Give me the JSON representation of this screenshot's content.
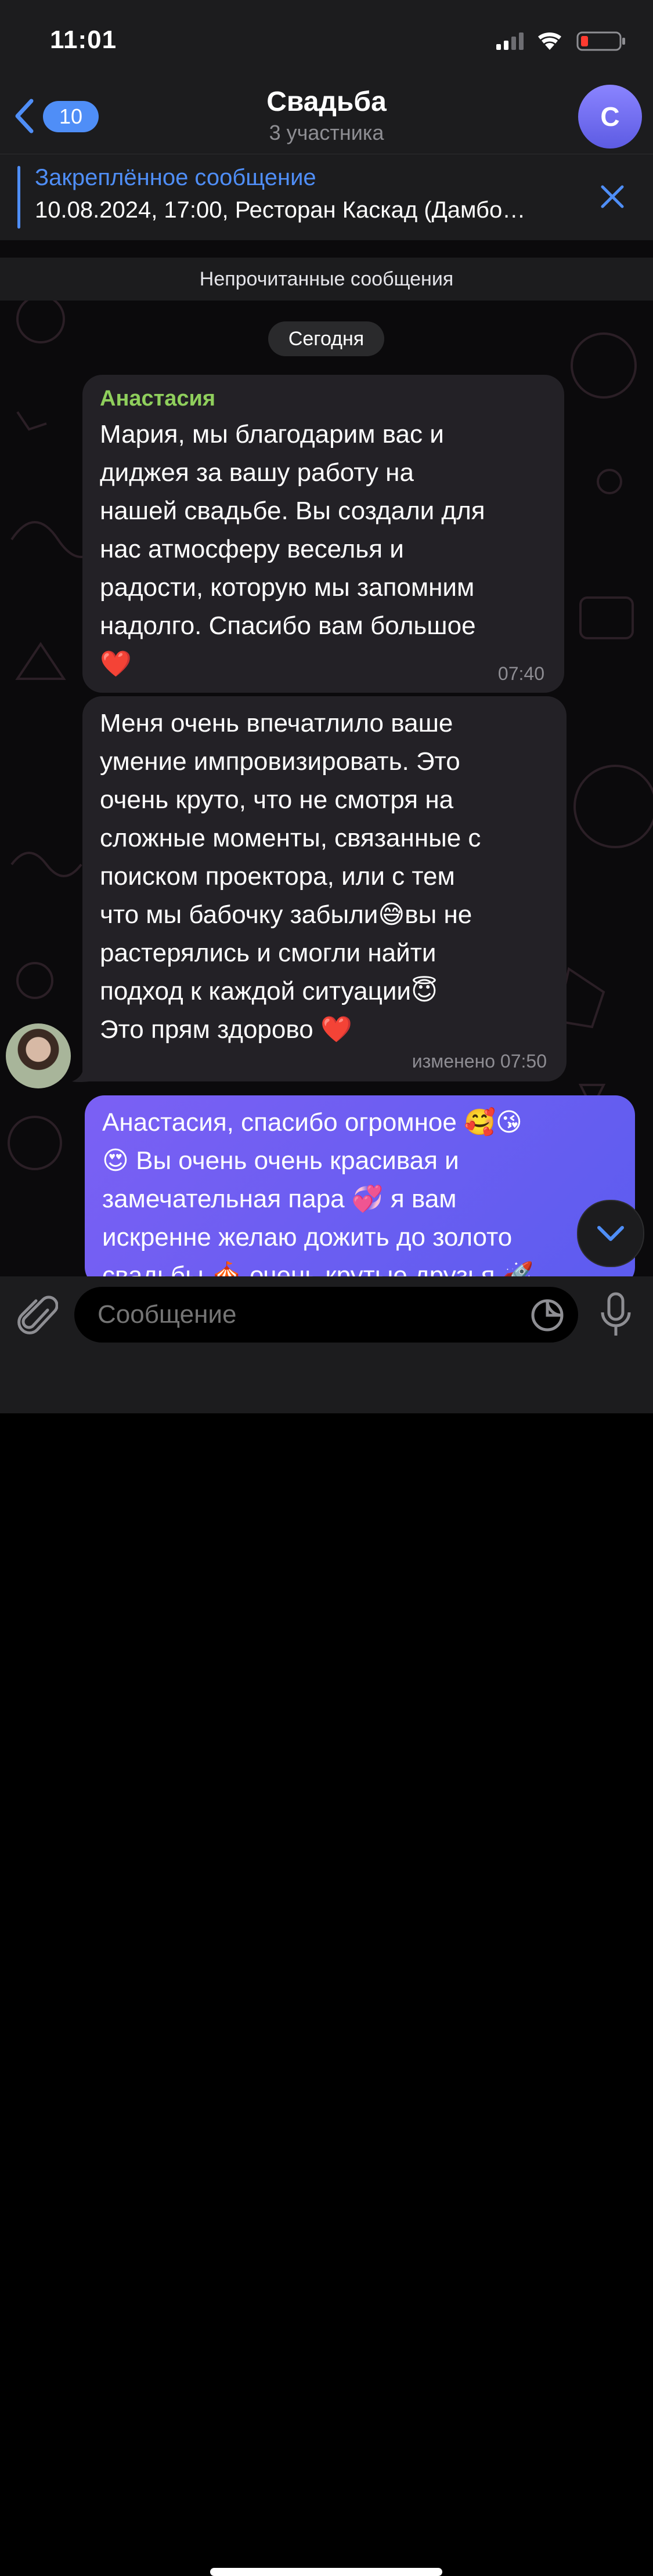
{
  "status_bar": {
    "time": "11:01"
  },
  "header": {
    "back_count": "10",
    "title": "Свадьба",
    "subtitle": "3 участника",
    "avatar_letter": "С"
  },
  "pinned": {
    "title": "Закреплённое сообщение",
    "text": "10.08.2024, 17:00, Ресторан Каскад (Дамбо…"
  },
  "unread_banner": "Непрочитанные сообщения",
  "date_separator": "Сегодня",
  "messages": [
    {
      "sender": "Анастасия",
      "text": "Мария, мы благодарим вас и\nдиджея за вашу работу на\nнашей свадьбе. Вы создали для\nнас атмосферу веселья и\nрадости, которую мы запомним\nнадолго. Спасибо вам большое\n❤️",
      "time": "07:40"
    },
    {
      "text": "Меня очень впечатлило ваше\nумение импровизировать. Это\nочень круто, что не смотря на\nсложные моменты, связанные с\nпоиском проектора, или с тем\nчто мы бабочку забыли😅вы не\nрастерялись и смогли найти\nподход к каждой ситуации😇\nЭто прям здорово ❤️",
      "meta": "изменено 07:50"
    },
    {
      "text": "Анастасия, спасибо огромное 🥰😘\n😍 Вы очень очень красивая и\nзамечательная  пара 💞 я вам\nискренне желаю дожить до золото\nсвадьбы 🎪 очень крутые друзья 🚀"
    }
  ],
  "composer": {
    "placeholder": "Сообщение"
  },
  "icons": {
    "back": "chevron-left-icon",
    "close": "close-icon",
    "attach": "paperclip-icon",
    "sticker": "sticker-icon",
    "mic": "microphone-icon",
    "scroll": "chevron-down-icon"
  },
  "colors": {
    "accent": "#4f8ef7",
    "sender_name": "#8fcf5c",
    "outgoing_bubble": "#6a5ef2",
    "incoming_bubble": "#232126"
  }
}
